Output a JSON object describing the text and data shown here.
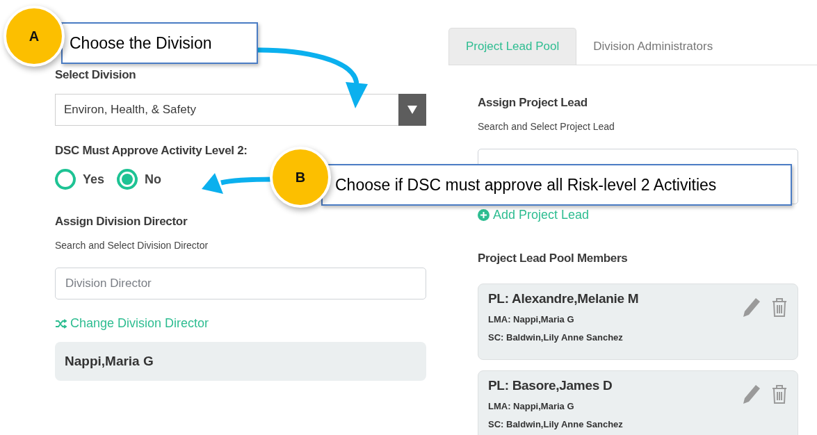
{
  "callouts": [
    {
      "badge": "A",
      "text": "Choose the Division"
    },
    {
      "badge": "B",
      "text": "Choose if DSC must approve all Risk-level 2 Activities"
    }
  ],
  "division": {
    "label": "Select Division",
    "value": "Environ, Health, & Safety"
  },
  "approval": {
    "label": "DSC Must Approve Activity Level 2:",
    "options": [
      {
        "label": "Yes",
        "selected": false
      },
      {
        "label": "No",
        "selected": true
      }
    ]
  },
  "director": {
    "heading": "Assign Division Director",
    "hint": "Search and Select Division Director",
    "placeholder": "Division Director",
    "link": "Change Division Director",
    "current": "Nappi,Maria G"
  },
  "tabs": [
    {
      "label": "Project Lead Pool",
      "selected": true
    },
    {
      "label": "Division Administrators",
      "selected": false
    }
  ],
  "project_lead": {
    "heading": "Assign Project Lead",
    "hint": "Search and Select Project Lead",
    "add_link": "Add Project Lead",
    "pool_heading": "Project Lead Pool Members",
    "members": [
      {
        "pl": "PL: Alexandre,Melanie M",
        "lma": "LMA: Nappi,Maria G",
        "sc": "SC: Baldwin,Lily Anne Sanchez"
      },
      {
        "pl": "PL: Basore,James D",
        "lma": "LMA: Nappi,Maria G",
        "sc": "SC: Baldwin,Lily Anne Sanchez"
      }
    ]
  }
}
